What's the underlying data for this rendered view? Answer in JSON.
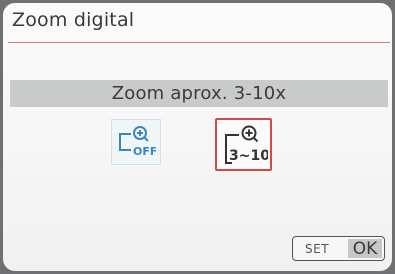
{
  "menu": {
    "title": "Zoom digital",
    "selection_label": "Zoom aprox. 3-10x"
  },
  "options": [
    {
      "icon": "zoom-off-icon",
      "text": "OFF",
      "selected": false
    },
    {
      "icon": "zoom-3-10-icon",
      "text": "3~10",
      "selected": true
    }
  ],
  "footer": {
    "set_label": "SET",
    "ok_label": "OK"
  },
  "colors": {
    "accent": "#d24a45",
    "icon_blue": "#3a87c0",
    "banner": "#c9cbca"
  }
}
